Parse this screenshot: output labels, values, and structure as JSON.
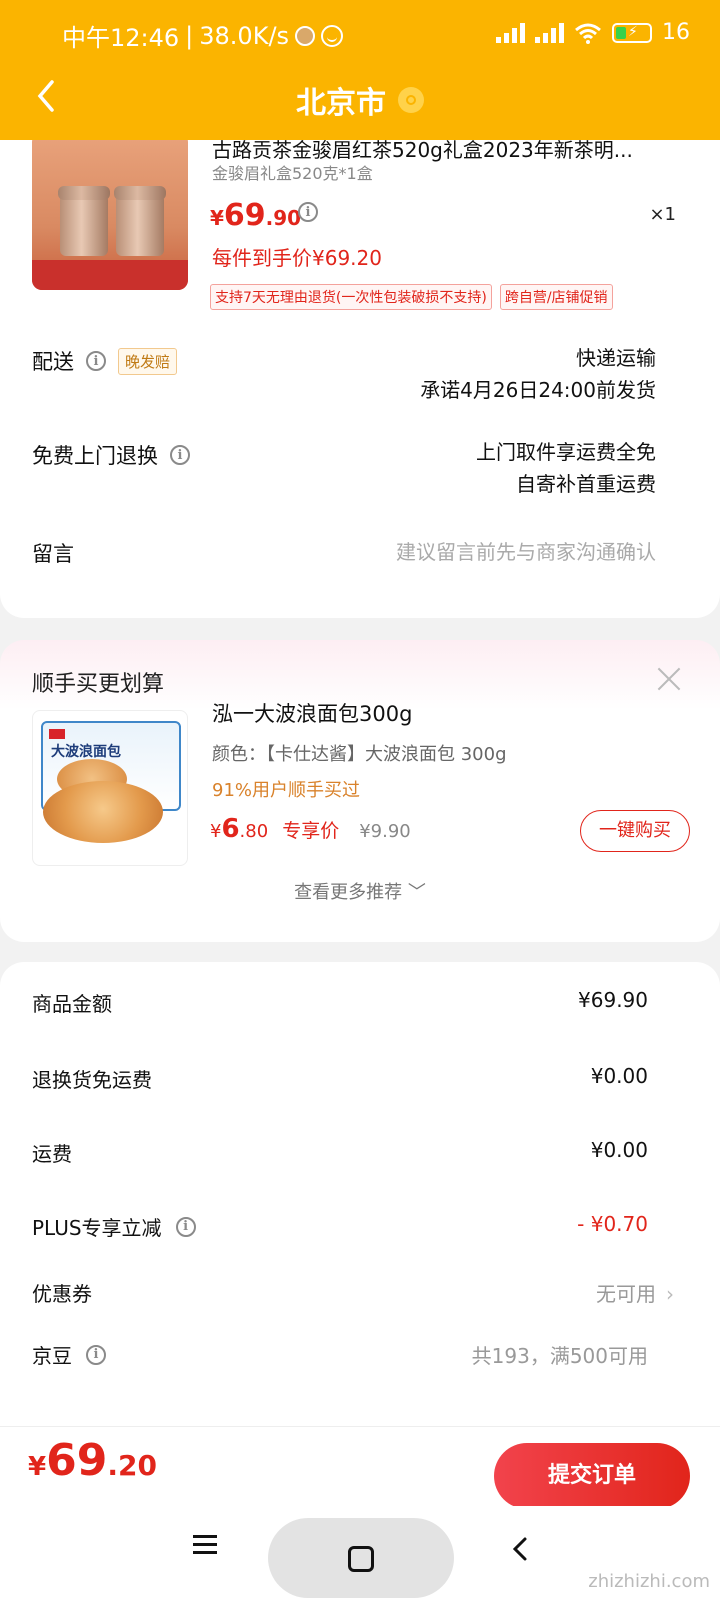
{
  "status_bar": {
    "time": "中午12:46",
    "speed": "38.0K/s",
    "battery": "16"
  },
  "header": {
    "city": "北京市"
  },
  "product": {
    "title": "古路贡茶金骏眉红茶520g礼盒2023年新茶明...",
    "spec": "金骏眉礼盒520克*1盒",
    "price_currency": "¥",
    "price_int": "69",
    "price_dec": ".90",
    "quantity": "×1",
    "hand_price": "每件到手价¥69.20",
    "tags": [
      "支持7天无理由退货(一次性包装破损不支持)",
      "跨自营/店铺促销"
    ]
  },
  "delivery": {
    "label": "配送",
    "badge": "晚发赔",
    "method": "快递运输",
    "promise": "承诺4月26日24:00前发货"
  },
  "return_service": {
    "label": "免费上门退换",
    "line1": "上门取件享运费全免",
    "line2": "自寄补首重运费"
  },
  "message": {
    "label": "留言",
    "placeholder": "建议留言前先与商家沟通确认"
  },
  "recommend": {
    "section_title": "顺手买更划算",
    "title": "泓一大波浪面包300g",
    "spec": "颜色：【卡仕达酱】大波浪面包 300g",
    "rate": "91%用户顺手买过",
    "price_currency": "¥",
    "price_int": "6",
    "price_dec": ".80",
    "exclusive_label": "专享价",
    "orig_price": "¥9.90",
    "buy_label": "一键购买",
    "more_label": "查看更多推荐",
    "image_text": "大波浪面包"
  },
  "summary": {
    "goods_amount_label": "商品金额",
    "goods_amount": "¥69.90",
    "return_freight_label": "退换货免运费",
    "return_freight": "¥0.00",
    "freight_label": "运费",
    "freight": "¥0.00",
    "plus_label": "PLUS专享立减",
    "plus_value": "- ¥0.70",
    "coupon_label": "优惠券",
    "coupon_value": "无可用",
    "beans_label": "京豆",
    "beans_value": "共193，满500可用"
  },
  "bottom": {
    "total_currency": "¥",
    "total_int": "69",
    "total_dec": ".20",
    "submit_label": "提交订单"
  },
  "watermark": "zhizhizhi.com",
  "colors": {
    "brand_yellow": "#fbb400",
    "price_red": "#e1251b"
  }
}
